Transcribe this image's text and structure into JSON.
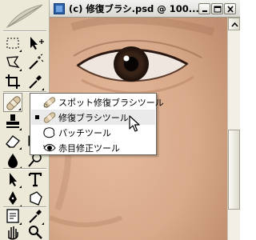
{
  "window": {
    "title": "(c) 修復ブラシ.psd @ 100..."
  },
  "toolbox": {
    "tools": [
      {
        "name": "marquee-tool",
        "icon": "dashed-rect-icon"
      },
      {
        "name": "move-tool",
        "icon": "move-arrow-icon"
      },
      {
        "name": "lasso-tool",
        "icon": "lasso-icon"
      },
      {
        "name": "magic-wand-tool",
        "icon": "magic-wand-icon"
      },
      {
        "name": "crop-tool",
        "icon": "crop-icon"
      },
      {
        "name": "eyedropper-tool",
        "icon": "eyedropper-icon"
      },
      {
        "name": "healing-brush-tool",
        "icon": "bandage-icon",
        "active": true
      },
      {
        "name": "brush-tool",
        "icon": "brush-icon"
      },
      {
        "name": "stamp-tool",
        "icon": "stamp-icon"
      },
      {
        "name": "history-brush-tool",
        "icon": "history-brush-icon"
      },
      {
        "name": "eraser-tool",
        "icon": "eraser-icon"
      },
      {
        "name": "gradient-tool",
        "icon": "gradient-icon"
      },
      {
        "name": "blur-tool",
        "icon": "drop-icon"
      },
      {
        "name": "dodge-tool",
        "icon": "dodge-icon"
      },
      {
        "name": "path-select-tool",
        "icon": "arrow-icon"
      },
      {
        "name": "type-tool",
        "icon": "type-T-icon"
      },
      {
        "name": "pen-tool",
        "icon": "pen-icon"
      },
      {
        "name": "shape-tool",
        "icon": "shape-icon"
      },
      {
        "name": "notes-tool",
        "icon": "note-icon"
      },
      {
        "name": "eyedropper-tool-2",
        "icon": "eyedropper-icon"
      },
      {
        "name": "hand-tool",
        "icon": "hand-icon"
      },
      {
        "name": "zoom-tool",
        "icon": "magnifier-icon"
      }
    ]
  },
  "flyout": {
    "items": [
      {
        "label": "スポット修復ブラシツール",
        "icon": "spot-healing-icon",
        "selected": false
      },
      {
        "label": "修復ブラシツール",
        "icon": "healing-brush-icon",
        "selected": true
      },
      {
        "label": "パッチツール",
        "icon": "patch-icon",
        "selected": false
      },
      {
        "label": "赤目修正ツール",
        "icon": "red-eye-icon",
        "selected": false
      }
    ]
  },
  "colors": {
    "skin": "#dcae90",
    "toolbox_bg": "#ece9d8",
    "menu_highlight": "#eaeaea"
  }
}
